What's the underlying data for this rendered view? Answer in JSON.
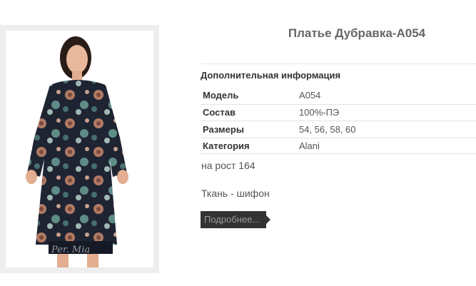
{
  "product": {
    "title": "Платье Дубравка-A054",
    "image_watermark": "Per. Mia"
  },
  "info": {
    "heading": "Дополнительная информация",
    "rows": [
      {
        "label": "Модель",
        "value": "A054"
      },
      {
        "label": "Состав",
        "value": "100%-ПЭ"
      },
      {
        "label": "Размеры",
        "value": "54, 56, 58, 60"
      },
      {
        "label": "Категория",
        "value": "Alani"
      }
    ],
    "height_note": "на рост 164",
    "fabric_note": "Ткань - шифон"
  },
  "actions": {
    "more_label": "Подробнее..."
  }
}
